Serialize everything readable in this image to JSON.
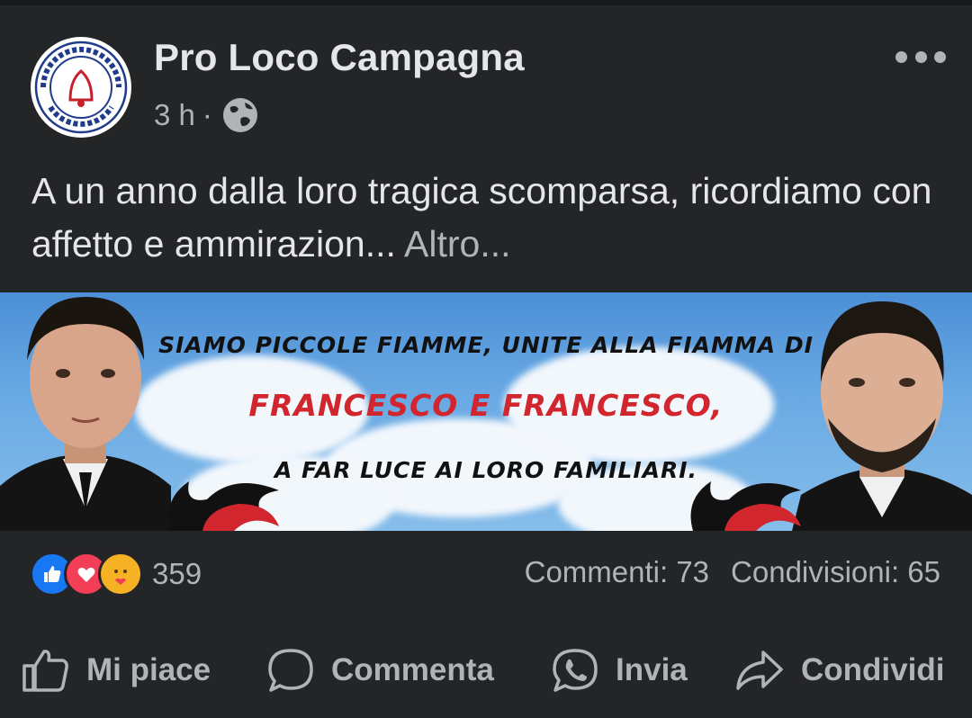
{
  "post": {
    "author": "Pro Loco Campagna",
    "avatar_ring_text": "PRO LOCO CITTA' DI CAMPAGNA",
    "time": "3 h",
    "separator": "·",
    "privacy_icon": "globe-icon",
    "menu_icon": "more-dots-icon",
    "text_main": "A un anno dalla loro tragica scomparsa, ricordiamo con affetto e ammirazion...",
    "text_more": "Altro..."
  },
  "banner": {
    "line1": "SIAMO PICCOLE FIAMME, UNITE ALLA FIAMMA DI",
    "line2": "FRANCESCO E FRANCESCO,",
    "line3": "A FAR LUCE AI LORO FAMILIARI."
  },
  "reactions": {
    "icons": [
      "like-icon",
      "love-icon",
      "care-icon"
    ],
    "colors": {
      "like": "#1877f2",
      "love": "#f33e58",
      "care": "#f7b125"
    },
    "count": "359"
  },
  "stats": {
    "comments": "Commenti: 73",
    "shares": "Condivisioni: 65"
  },
  "actions": {
    "like": "Mi piace",
    "comment": "Commenta",
    "send": "Invia",
    "share": "Condividi"
  }
}
